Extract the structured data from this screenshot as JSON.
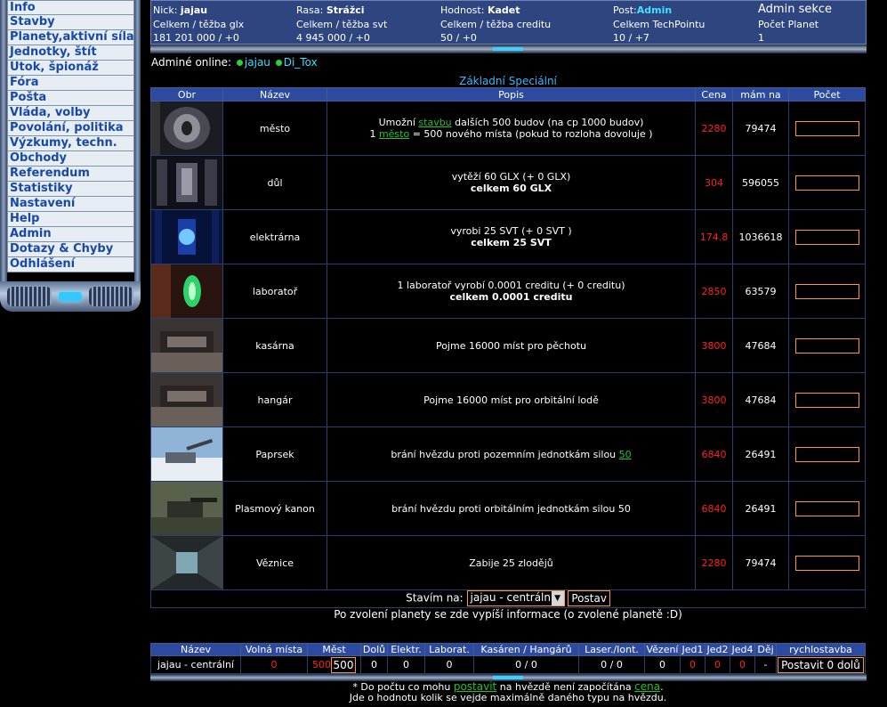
{
  "menu": {
    "items": [
      "Info",
      "Stavby",
      "Planety,aktivní síla",
      "Jednotky, štít",
      "Útok, špionáž",
      "Fóra",
      "Pošta",
      "Vláda, volby",
      "Povolání, politika",
      "Výzkumy, techn.",
      "Obchody",
      "Referendum",
      "Statistiky",
      "Nastavení",
      "Help",
      "Admin",
      "Dotazy & Chyby",
      "Odhlášení"
    ]
  },
  "header": {
    "nick_label": "Nick:",
    "nick": "jajau",
    "race_label": "Rasa:",
    "race": "Strážci",
    "rank_label": "Hodnost:",
    "rank": "Kadet",
    "post_label": "Post:",
    "post": "Admin",
    "admin_section": "Admin sekce",
    "glx_label": "Celkem / těžba glx",
    "glx_value": "181 201 000 / +0",
    "svt_label": "Celkem / těžba svt",
    "svt_value": "4 945 000 / +0",
    "credit_label": "Celkem / těžba creditu",
    "credit_value": "50 / +0",
    "tp_label": "Celkem TechPointu",
    "tp_value": "10 / +7",
    "planets_label": "Počet Planet",
    "planets_value": "1"
  },
  "admins": {
    "label": "Adminé online:",
    "names": [
      "jajau",
      "Di_Tox"
    ]
  },
  "tabs": {
    "basic": "Základní",
    "special": "Speciální"
  },
  "table": {
    "headers": [
      "Obr",
      "Název",
      "Popis",
      "Cena",
      "mám na",
      "Počet"
    ],
    "rows": [
      {
        "name": "město",
        "desc1_pre": "Umožní ",
        "desc1_link": "stavbu",
        "desc1_post": " dalších 500 budov (na cp 1000 budov)",
        "desc2_pre": "1 ",
        "desc2_link": "město",
        "desc2_post": " = 500 nového místa (pokud to rozloha dovoluje )",
        "price": "2280",
        "can_afford": "79474",
        "thumb": "tunnel"
      },
      {
        "name": "důl",
        "desc1": "vytěží 60 GLX (+ 0 GLX)",
        "desc2": "celkem 60 GLX",
        "price": "304",
        "can_afford": "596055",
        "thumb": "mine"
      },
      {
        "name": "elektrárna",
        "desc1": "vyrobi 25 SVT (+ 0 SVT )",
        "desc2": "celkem 25 SVT",
        "price": "174.8",
        "can_afford": "1036618",
        "thumb": "power"
      },
      {
        "name": "laboratoř",
        "desc1": "1 laboratoř vyrobí 0.0001 creditu (+ 0 creditu)",
        "desc2": "celkem 0.0001 creditu",
        "price": "2850",
        "can_afford": "63579",
        "thumb": "lab"
      },
      {
        "name": "kasárna",
        "desc1": "Pojme 16000 míst pro pěchotu",
        "desc2": "",
        "price": "3800",
        "can_afford": "47684",
        "thumb": "hangar"
      },
      {
        "name": "hangár",
        "desc1": "Pojme 16000 míst pro orbitální lodě",
        "desc2": "",
        "price": "3800",
        "can_afford": "47684",
        "thumb": "hangar"
      },
      {
        "name": "Paprsek",
        "desc1_pre": "brání hvězdu proti pozemním jednotkám silou ",
        "desc1_link": "50",
        "price": "6840",
        "can_afford": "26491",
        "thumb": "snow"
      },
      {
        "name": "Plasmový kanon",
        "desc1": "brání hvězdu proti orbitálním jednotkám silou 50",
        "desc2": "",
        "price": "6840",
        "can_afford": "26491",
        "thumb": "cannon"
      },
      {
        "name": "Věznice",
        "desc1": "Zabije 25 zlodějů",
        "desc2": "",
        "price": "2280",
        "can_afford": "79474",
        "thumb": "corridor"
      }
    ]
  },
  "build": {
    "label": "Stavím na:",
    "planet": "jajau - centrální",
    "button": "Postav"
  },
  "info_line": "Po zvolení planety se zde vypíší informace (o zvolené planetě :D)",
  "summary": {
    "headers": [
      "Název",
      "Volná místa",
      "Měst",
      "Dolů",
      "Elektr.",
      "Laborat.",
      "Kasáren / Hangárů",
      "Laser./Iont.",
      "Vězení",
      "Jed1",
      "Jed2",
      "Jed4",
      "Děj",
      "rychlostavba"
    ],
    "row": {
      "name": "jajau - centrální",
      "free": "0",
      "cities_red": "500",
      "cities_input": "500",
      "mines": "0",
      "power": "0",
      "labs": "0",
      "barracks": "0 / 0",
      "laser": "0 / 0",
      "prison": "0",
      "jed1": "0",
      "jed2": "0",
      "jed4": "0",
      "dej": "-",
      "quick_button": "Postavit 0 dolů"
    }
  },
  "notes": {
    "line1_pre": "* Do počtu co mohu ",
    "line1_link1": "postavit",
    "line1_mid": " na hvězdě není započítána ",
    "line1_link2": "cena",
    "line1_post": ".",
    "line2": "Jde o hodnotu kolik se vejde maximálně daného typu na hvězdu."
  }
}
